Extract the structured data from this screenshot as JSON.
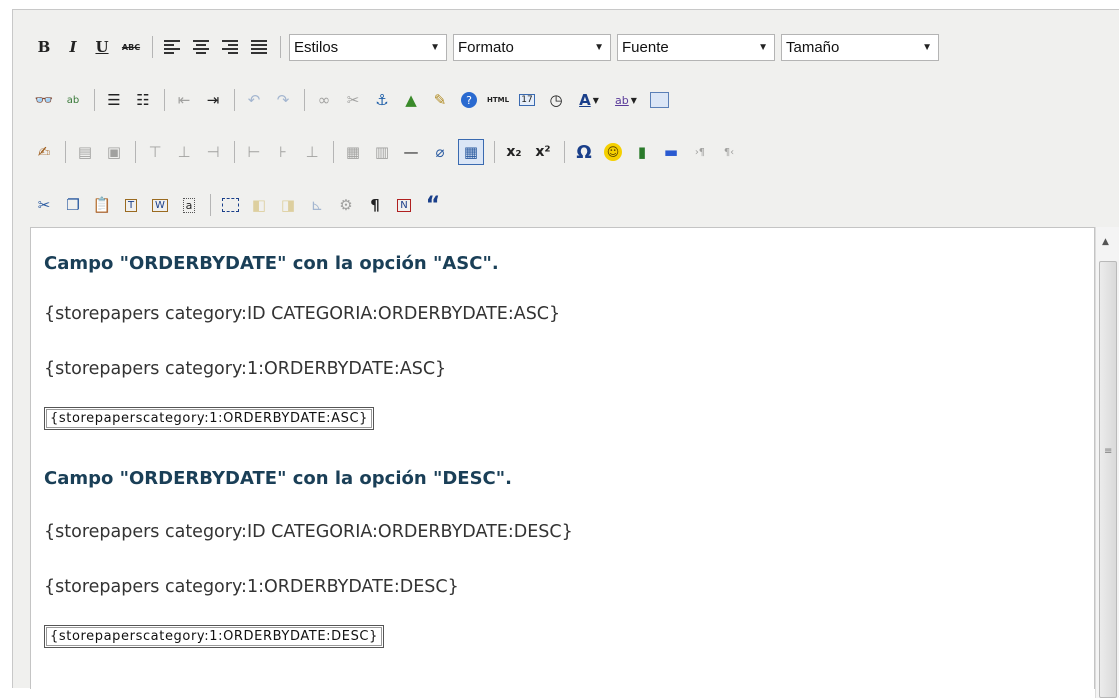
{
  "toolbar": {
    "row1": {
      "bold": "B",
      "italic": "I",
      "underline": "U",
      "strike": "ABC",
      "dropdowns": [
        "Estilos",
        "Formato",
        "Fuente",
        "Tamaño"
      ]
    },
    "row2_icons": [
      "find-replace-icon",
      "spellcheck-icon",
      "unordered-list-icon",
      "ordered-list-icon",
      "outdent-icon",
      "indent-icon",
      "undo-icon",
      "redo-icon",
      "link-icon",
      "unlink-icon",
      "anchor-icon",
      "image-icon",
      "cleanup-icon",
      "help-icon",
      "html-icon",
      "insert-date-icon",
      "insert-time-icon",
      "font-color-icon",
      "highlight-color-icon",
      "fullscreen-icon"
    ],
    "html_label": "HTML",
    "font_color_label": "A",
    "highlight_label": "ab",
    "row3_extra": {
      "subscript": "x₂",
      "superscript": "x²",
      "omega": "Ω"
    },
    "pilcrow": "¶",
    "quote": "“"
  },
  "content": {
    "heading_asc": "Campo \"ORDERBYDATE\" con la opción \"ASC\".",
    "line_asc_1": "{storepapers category:ID CATEGORIA:ORDERBYDATE:ASC}",
    "line_asc_2": "{storepapers category:1:ORDERBYDATE:ASC}",
    "boxed_asc": "{storepaperscategory:1:ORDERBYDATE:ASC}",
    "heading_desc": "Campo \"ORDERBYDATE\" con la opción \"DESC\".",
    "line_desc_1": "{storepapers category:ID CATEGORIA:ORDERBYDATE:DESC}",
    "line_desc_2": "{storepapers category:1:ORDERBYDATE:DESC}",
    "boxed_desc": "{storepaperscategory:1:ORDERBYDATE:DESC}"
  },
  "colors": {
    "heading": "#1a3f57",
    "text": "#333333",
    "toolbar_bg": "#f0f0ee"
  }
}
